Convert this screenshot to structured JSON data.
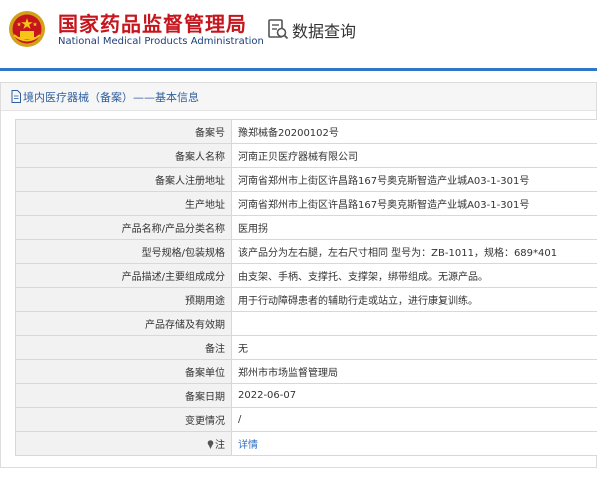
{
  "header": {
    "logo_cn": "国家药品监督管理局",
    "logo_en": "National Medical Products Administration",
    "search_title": "数据查询"
  },
  "breadcrumb": "境内医疗器械（备案）——基本信息",
  "rows": [
    {
      "label": "备案号",
      "value": "豫郑械备20200102号"
    },
    {
      "label": "备案人名称",
      "value": "河南正贝医疗器械有限公司"
    },
    {
      "label": "备案人注册地址",
      "value": "河南省郑州市上街区许昌路167号奥克斯智造产业城A03-1-301号"
    },
    {
      "label": "生产地址",
      "value": "河南省郑州市上街区许昌路167号奥克斯智造产业城A03-1-301号"
    },
    {
      "label": "产品名称/产品分类名称",
      "value": "医用拐"
    },
    {
      "label": "型号规格/包装规格",
      "value": "该产品分为左右腿，左右尺寸相同 型号为：ZB-1011，规格：689*401"
    },
    {
      "label": "产品描述/主要组成成分",
      "value": "由支架、手柄、支撑托、支撑架，绑带组成。无源产品。"
    },
    {
      "label": "预期用途",
      "value": "用于行动障碍患者的辅助行走或站立，进行康复训练。"
    },
    {
      "label": "产品存储及有效期",
      "value": ""
    },
    {
      "label": "备注",
      "value": "无"
    },
    {
      "label": "备案单位",
      "value": "郑州市市场监督管理局"
    },
    {
      "label": "备案日期",
      "value": "2022-06-07"
    },
    {
      "label": "变更情况",
      "value": "/"
    },
    {
      "label": "注",
      "value": "详情"
    }
  ],
  "colors": {
    "brand_red": "#c5161d",
    "accent_blue": "#2f77c8",
    "link_blue": "#2f6fc0"
  },
  "icons": {
    "emblem": "national-emblem-icon",
    "search": "search-doc-icon",
    "breadcrumb": "document-icon",
    "note": "pin-icon"
  }
}
